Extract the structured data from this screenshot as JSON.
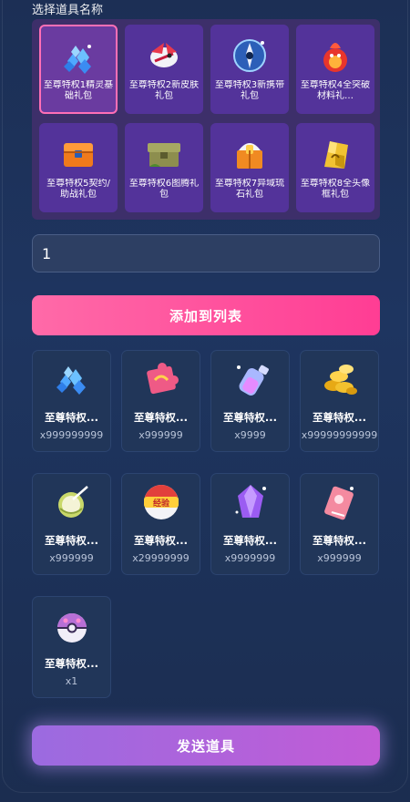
{
  "picker": {
    "title": "选择道具名称",
    "items": [
      {
        "label": "至尊特权1精灵基础礼包",
        "icon": "blue-crystals-icon",
        "selected": true
      },
      {
        "label": "至尊特权2新皮肤礼包",
        "icon": "winged-creature-icon",
        "selected": false
      },
      {
        "label": "至尊特权3新携带礼包",
        "icon": "star-badge-icon",
        "selected": false
      },
      {
        "label": "至尊特权4全突破材料礼…",
        "icon": "fire-dragon-icon",
        "selected": false
      },
      {
        "label": "至尊特权5契约/助战礼包",
        "icon": "orange-chest-icon",
        "selected": false
      },
      {
        "label": "至尊特权6图腾礼包",
        "icon": "mossy-chest-icon",
        "selected": false
      },
      {
        "label": "至尊特权7异域琉石礼包",
        "icon": "orange-box-icon",
        "selected": false
      },
      {
        "label": "至尊特权8全头像框礼包",
        "icon": "golden-gem-icon",
        "selected": false
      }
    ]
  },
  "quantity": {
    "value": "1"
  },
  "add_button": {
    "label": "添加到列表"
  },
  "list": [
    {
      "name": "至尊特权...",
      "count": "x999999999",
      "icon": "blue-crystals-icon"
    },
    {
      "name": "至尊特权...",
      "count": "x999999",
      "icon": "puzzle-piece-icon"
    },
    {
      "name": "至尊特权...",
      "count": "x9999",
      "icon": "potion-bottle-icon"
    },
    {
      "name": "至尊特权...",
      "count": "x99999999999",
      "icon": "gold-coins-icon"
    },
    {
      "name": "至尊特权...",
      "count": "x999999",
      "icon": "coconut-drink-icon"
    },
    {
      "name": "至尊特权...",
      "count": "x29999999",
      "icon": "exp-ball-icon"
    },
    {
      "name": "至尊特权...",
      "count": "x9999999",
      "icon": "purple-crystal-icon"
    },
    {
      "name": "至尊特权...",
      "count": "x999999",
      "icon": "pink-ticket-icon"
    },
    {
      "name": "至尊特权...",
      "count": "x1",
      "icon": "purple-capsule-ball-icon"
    }
  ],
  "exp_ball_text": "经验",
  "send_button": {
    "label": "发送道具"
  },
  "colors": {
    "accent_pink": "#ff3d94",
    "accent_purple": "#b05ed9",
    "selected_border": "#ff6fb6"
  }
}
